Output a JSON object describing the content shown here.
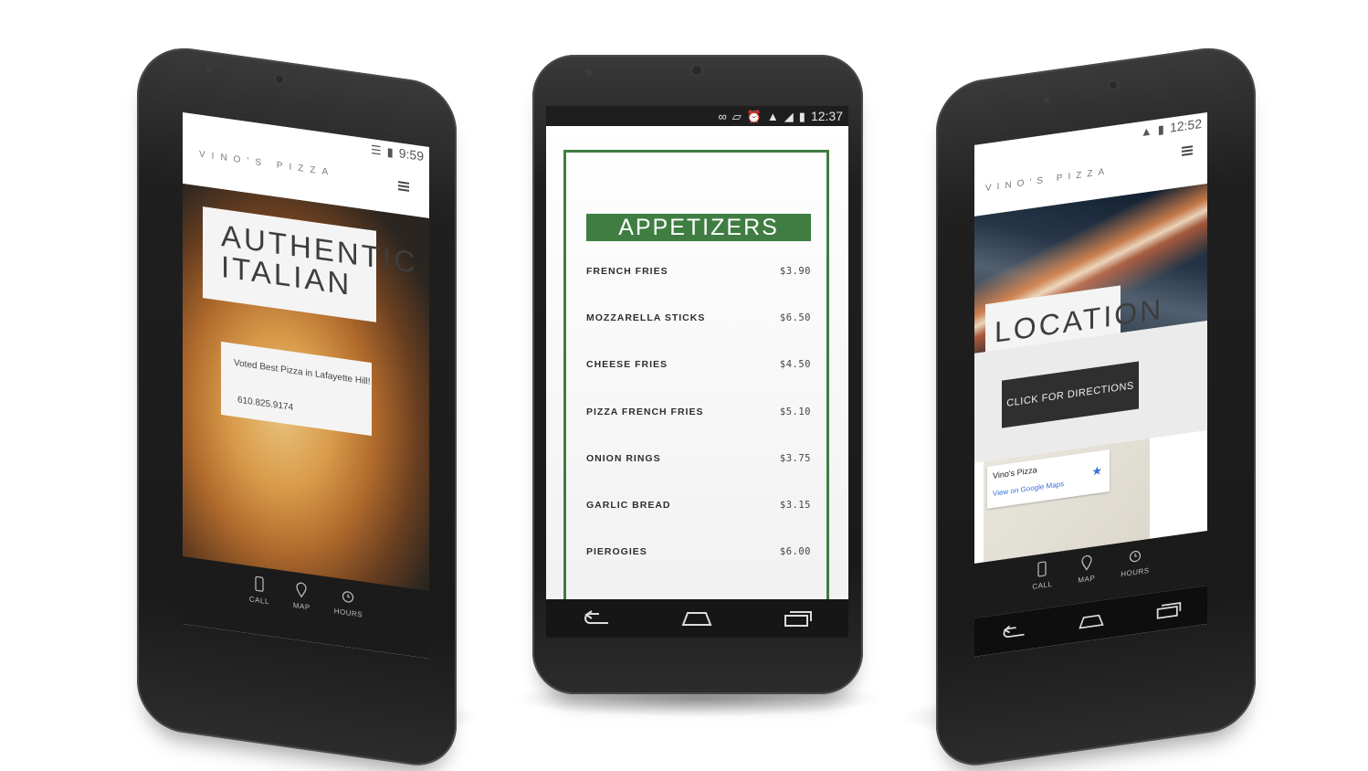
{
  "center": {
    "status": {
      "time": "12:37"
    },
    "menu": {
      "heading": "APPETIZERS",
      "items": [
        {
          "name": "FRENCH FRIES",
          "price": "$3.90"
        },
        {
          "name": "MOZZARELLA STICKS",
          "price": "$6.50"
        },
        {
          "name": "CHEESE FRIES",
          "price": "$4.50"
        },
        {
          "name": "PIZZA FRENCH FRIES",
          "price": "$5.10"
        },
        {
          "name": "ONION RINGS",
          "price": "$3.75"
        },
        {
          "name": "GARLIC BREAD",
          "price": "$3.15"
        },
        {
          "name": "PIEROGIES",
          "price": "$6.00"
        }
      ]
    },
    "nav": {
      "icons": [
        "back-icon",
        "home-icon",
        "recents-icon"
      ]
    }
  },
  "left": {
    "status": {
      "time": "9:59"
    },
    "brand": "VINO'S PIZZA",
    "hero_title": "AUTHENTIC ITALIAN",
    "info": {
      "tagline": "Voted Best Pizza in Lafayette Hill!",
      "phone": "610.825.9174"
    },
    "tabs": [
      {
        "label": "CALL",
        "icon": "phone-icon"
      },
      {
        "label": "MAP",
        "icon": "map-pin-icon"
      },
      {
        "label": "HOURS",
        "icon": "clock-icon"
      }
    ]
  },
  "right": {
    "status": {
      "time": "12:52"
    },
    "brand": "VINO'S PIZZA",
    "hero_title": "LOCATION",
    "directions_label": "CLICK FOR DIRECTIONS",
    "map": {
      "place": "Vino's Pizza",
      "link": "View on Google Maps"
    },
    "tabs": [
      {
        "label": "CALL",
        "icon": "phone-icon"
      },
      {
        "label": "MAP",
        "icon": "map-pin-icon"
      },
      {
        "label": "HOURS",
        "icon": "clock-icon"
      }
    ]
  },
  "colors": {
    "accent_green": "#3f7d42",
    "dark_button": "#2f2f2f",
    "link_blue": "#3a6fd8"
  }
}
